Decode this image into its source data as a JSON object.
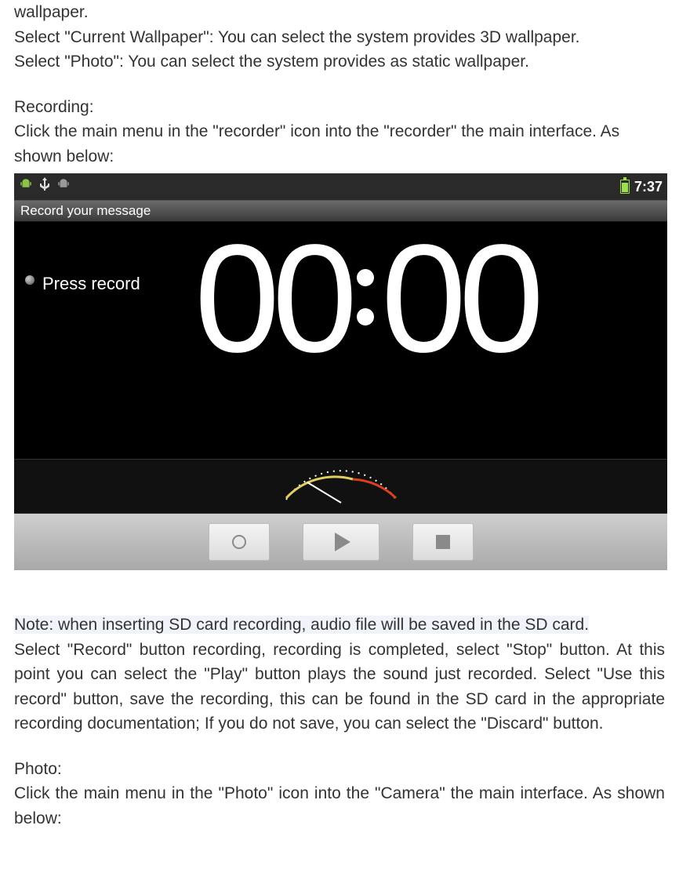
{
  "doc": {
    "wallpaper_tail": "wallpaper.",
    "current_wallpaper": "Select \"Current Wallpaper\": You can select the system provides 3D wallpaper.",
    "photo_wallpaper": "Select \"Photo\": You can select the system provides as static wallpaper.",
    "recording_heading": "Recording:",
    "recording_intro": "Click the main menu in the \"recorder\" icon into the \"recorder\" the main interface. As shown below:",
    "note_line": "Note: when inserting SD card recording, audio file will be saved in the SD card.",
    "record_instructions": "Select \"Record\" button recording, recording is completed, select \"Stop\" button. At this point you can select the \"Play\" button plays the sound just recorded. Select \"Use this record\" button, save the recording, this can be found in the SD card in the appropriate recording documentation; If you do not save, you can select the \"Discard\" button.",
    "photo_heading": "Photo:",
    "photo_intro": "Click the main menu in the \"Photo\" icon into the \"Camera\" the main interface. As shown below:"
  },
  "recorder": {
    "statusbar": {
      "time": "7:37",
      "icons": {
        "android": "android-icon",
        "usb": "usb-icon",
        "debug": "debug-icon",
        "battery": "battery-icon"
      }
    },
    "title": "Record your message",
    "hint": "Press record",
    "timer": {
      "minutes": "00",
      "seconds": "00"
    },
    "toolbar": {
      "record": "record-button",
      "play": "play-button",
      "stop": "stop-button"
    }
  }
}
